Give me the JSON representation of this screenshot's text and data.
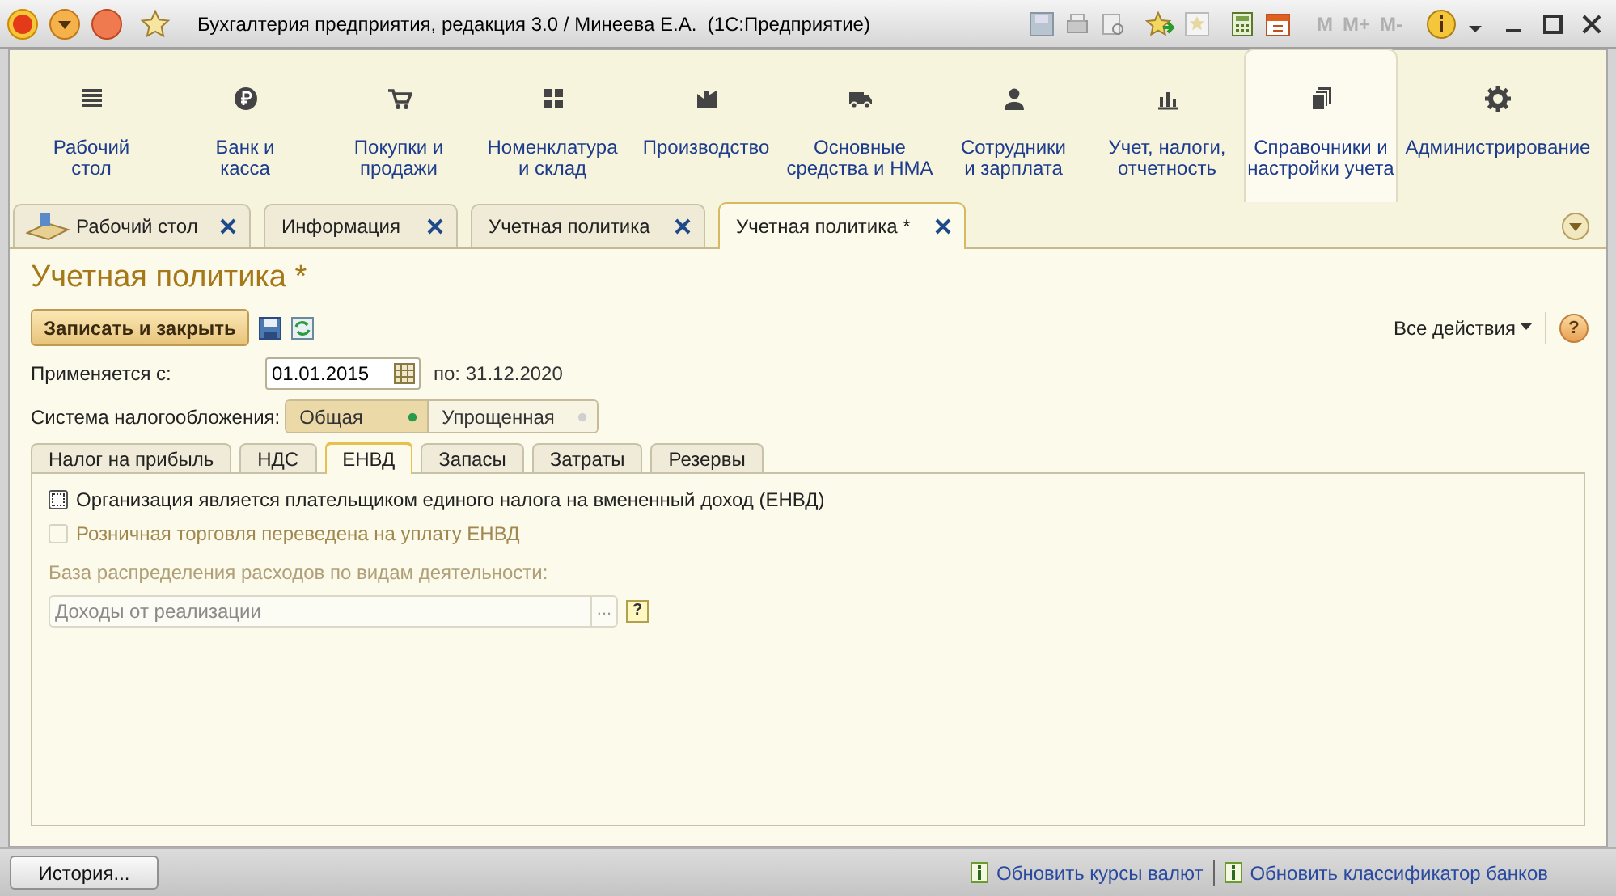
{
  "window": {
    "title": "Бухгалтерия предприятия, редакция 3.0 / Минеева Е.А.  (1С:Предприятие)",
    "memory_buttons": [
      "M",
      "M+",
      "M-"
    ]
  },
  "sections": [
    {
      "label": "Рабочий\nстол",
      "selected": false
    },
    {
      "label": "Банк и\nкасса",
      "selected": false
    },
    {
      "label": "Покупки и\nпродажи",
      "selected": false
    },
    {
      "label": "Номенклатура\nи склад",
      "selected": false
    },
    {
      "label": "Производство",
      "selected": false
    },
    {
      "label": "Основные\nсредства и НМА",
      "selected": false
    },
    {
      "label": "Сотрудники\nи зарплата",
      "selected": false
    },
    {
      "label": "Учет, налоги,\nотчетность",
      "selected": false
    },
    {
      "label": "Справочники и\nнастройки учета",
      "selected": true
    },
    {
      "label": "Администрирование",
      "selected": false
    }
  ],
  "open_tabs": [
    {
      "label": "Рабочий стол",
      "selected": false
    },
    {
      "label": "Информация",
      "selected": false
    },
    {
      "label": "Учетная политика",
      "selected": false
    },
    {
      "label": "Учетная политика *",
      "selected": true
    }
  ],
  "form": {
    "title": "Учетная политика *",
    "save_close_button": "Записать и закрыть",
    "all_actions": "Все действия",
    "help": "?",
    "applies_from": {
      "label": "Применяется с:",
      "value": "01.01.2015",
      "until": "по: 31.12.2020"
    },
    "tax_system": {
      "label": "Система налогообложения:",
      "options": [
        {
          "label": "Общая",
          "selected": true
        },
        {
          "label": "Упрощенная",
          "selected": false
        }
      ]
    },
    "tabs": [
      {
        "label": "Налог на прибыль",
        "selected": false
      },
      {
        "label": "НДС",
        "selected": false
      },
      {
        "label": "ЕНВД",
        "selected": true
      },
      {
        "label": "Запасы",
        "selected": false
      },
      {
        "label": "Затраты",
        "selected": false
      },
      {
        "label": "Резервы",
        "selected": false
      }
    ],
    "envd_payer": {
      "label": "Организация является плательщиком единого налога на вмененный доход (ЕНВД)",
      "checked": false,
      "disabled": false
    },
    "retail_envd": {
      "label": "Розничная торговля переведена на уплату ЕНВД",
      "checked": false,
      "disabled": true
    },
    "distribution_base": {
      "label": "База распределения расходов по видам деятельности:",
      "value": "Доходы от реализации",
      "button": "...",
      "help": "?"
    }
  },
  "status_bar": {
    "history_button": "История...",
    "links": [
      "Обновить курсы валют",
      "Обновить классификатор банков"
    ]
  }
}
